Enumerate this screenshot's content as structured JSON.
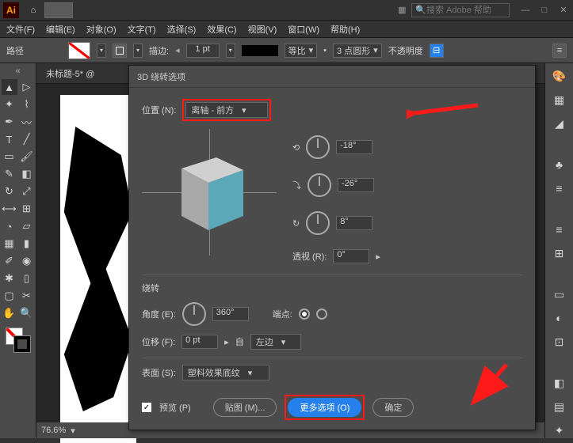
{
  "titlebar": {
    "logo": "Ai",
    "search_placeholder": "搜索 Adobe 帮助"
  },
  "menu": [
    "文件(F)",
    "编辑(E)",
    "对象(O)",
    "文字(T)",
    "选择(S)",
    "效果(C)",
    "视图(V)",
    "窗口(W)",
    "帮助(H)"
  ],
  "control": {
    "path_label": "路径",
    "stroke_label": "描边:",
    "stroke_width": "1 pt",
    "ratio": "等比",
    "points": "3 点圆形",
    "opacity_label": "不透明度"
  },
  "doc_tab": "未标题-5* @",
  "zoom": "76.6%",
  "dialog": {
    "title": "3D 绕转选项",
    "position_label": "位置 (N):",
    "position_value": "离轴 - 前方",
    "rot_x": "-18°",
    "rot_y": "-26°",
    "rot_z": "8°",
    "perspective_label": "透视 (R):",
    "perspective_value": "0°",
    "revolve_section": "绕转",
    "angle_label": "角度 (E):",
    "angle_value": "360°",
    "cap_label": "端点:",
    "offset_label": "位移 (F):",
    "offset_value": "0 pt",
    "from_label": "自",
    "from_value": "左边",
    "surface_label": "表面 (S):",
    "surface_value": "塑料效果底纹",
    "preview_label": "预览 (P)",
    "map_art": "贴图 (M)...",
    "more_options": "更多选项 (O)",
    "ok": "确定"
  }
}
